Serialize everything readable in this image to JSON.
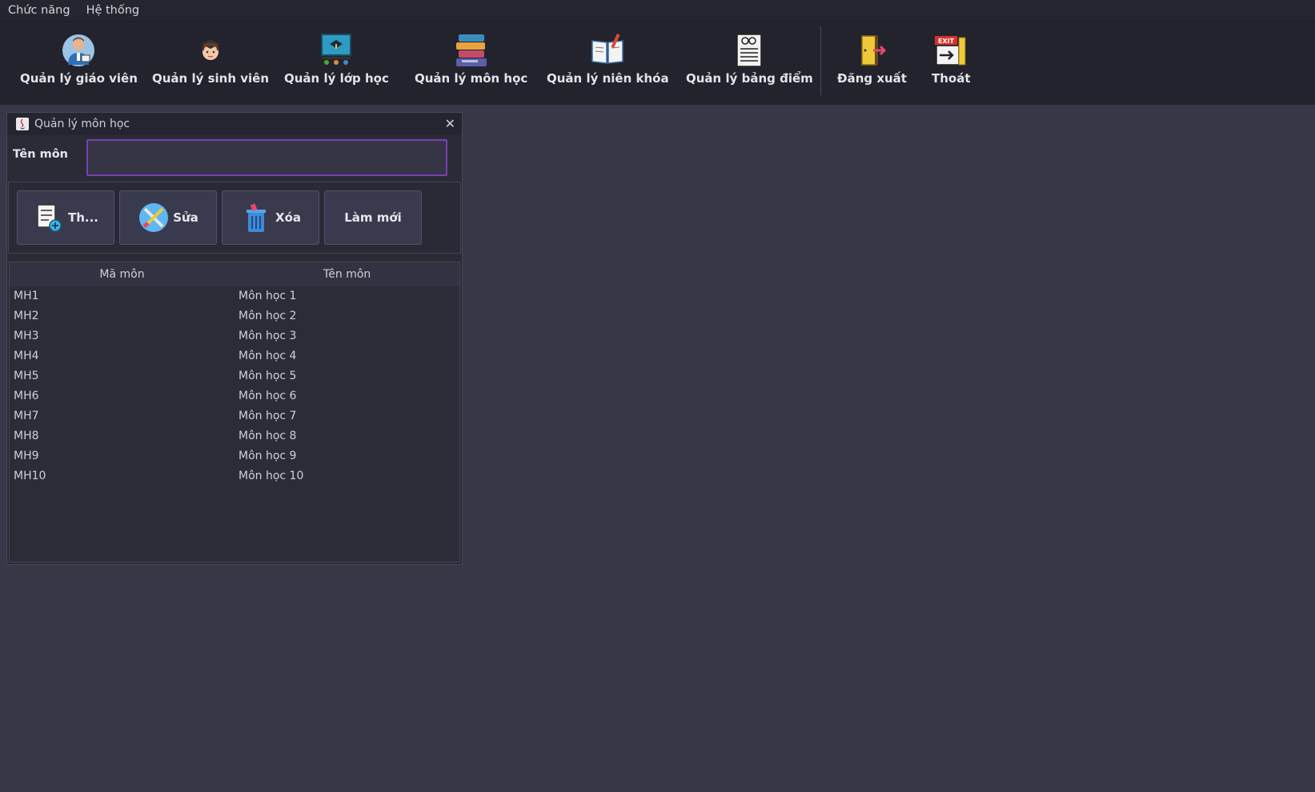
{
  "menu": [
    "Chức năng",
    "Hệ thống"
  ],
  "toolbar": {
    "buttons": [
      {
        "label": "Quản lý giáo viên",
        "icon": "teacher-icon"
      },
      {
        "label": "Quản lý sinh viên",
        "icon": "student-icon"
      },
      {
        "label": "Quản lý lớp học",
        "icon": "classroom-icon"
      },
      {
        "label": "Quản lý môn học",
        "icon": "books-icon"
      },
      {
        "label": "Quản lý niên khóa",
        "icon": "open-book-icon"
      },
      {
        "label": "Quản lý bảng điểm",
        "icon": "report-sheet-icon"
      },
      {
        "label": "Đăng xuất",
        "icon": "logout-door-icon"
      },
      {
        "label": "Thoát",
        "icon": "exit-sign-icon"
      }
    ]
  },
  "window": {
    "title": "Quản lý môn học",
    "close_glyph": "✕",
    "field_label": "Tên môn",
    "field_value": "",
    "buttons": [
      {
        "label": "Th...",
        "icon": "add-list-icon"
      },
      {
        "label": "Sửa",
        "icon": "tools-icon"
      },
      {
        "label": "Xóa",
        "icon": "trash-icon"
      },
      {
        "label": "Làm mới",
        "icon": ""
      }
    ]
  },
  "table": {
    "columns": [
      "Mã môn",
      "Tên môn"
    ],
    "rows": [
      [
        "MH1",
        "Môn học 1"
      ],
      [
        "MH2",
        "Môn học 2"
      ],
      [
        "MH3",
        "Môn học 3"
      ],
      [
        "MH4",
        "Môn học 4"
      ],
      [
        "MH5",
        "Môn học 5"
      ],
      [
        "MH6",
        "Môn học 6"
      ],
      [
        "MH7",
        "Môn học 7"
      ],
      [
        "MH8",
        "Môn học 8"
      ],
      [
        "MH9",
        "Môn học 9"
      ],
      [
        "MH10",
        "Môn học 10"
      ]
    ]
  },
  "colors": {
    "background": "#373748",
    "toolbar": "#23232d",
    "input_border": "#7a3fb0"
  }
}
